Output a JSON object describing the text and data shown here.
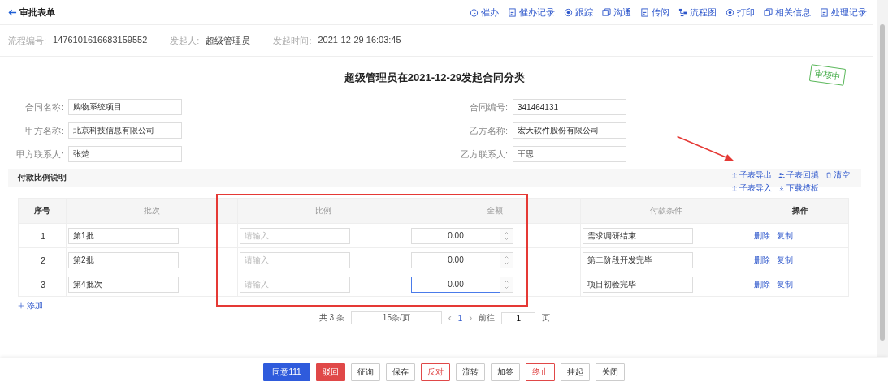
{
  "header": {
    "back_title": "审批表单",
    "actions": [
      "催办",
      "催办记录",
      "跟踪",
      "沟通",
      "传阅",
      "流程图",
      "打印",
      "相关信息",
      "处理记录"
    ]
  },
  "meta": [
    {
      "label": "流程编号:",
      "value": "1476101616683159552"
    },
    {
      "label": "发起人:",
      "value": "超级管理员"
    },
    {
      "label": "发起时间:",
      "value": "2021-12-29 16:03:45"
    }
  ],
  "form_title": "超级管理员在2021-12-29发起合同分类",
  "stamp": "审核中",
  "fields": [
    {
      "label": "合同名称:",
      "value": "购物系统项目"
    },
    {
      "label": "合同编号:",
      "value": "341464131"
    },
    {
      "label": "甲方名称:",
      "value": "北京科技信息有限公司"
    },
    {
      "label": "乙方名称:",
      "value": "宏天软件股份有限公司"
    },
    {
      "label": "甲方联系人:",
      "value": "张楚"
    },
    {
      "label": "乙方联系人:",
      "value": "王思"
    }
  ],
  "subtable": {
    "title": "付款比例说明",
    "tools_row1": [
      "子表导出",
      "子表回填",
      "清空"
    ],
    "tools_row2": [
      "子表导入",
      "下载模板"
    ],
    "columns": [
      "序号",
      "批次",
      "比例",
      "金额",
      "付款条件",
      "操作"
    ],
    "rows": [
      {
        "seq": "1",
        "batch": "第1批",
        "ratio_placeholder": "请输入",
        "amount": "0.00",
        "amount_focused": false,
        "condition": "需求调研结束",
        "actions": [
          "删除",
          "复制"
        ]
      },
      {
        "seq": "2",
        "batch": "第2批",
        "ratio_placeholder": "请输入",
        "amount": "0.00",
        "amount_focused": false,
        "condition": "第二阶段开发完毕",
        "actions": [
          "删除",
          "复制"
        ]
      },
      {
        "seq": "3",
        "batch": "第4批次",
        "ratio_placeholder": "请输入",
        "amount": "0.00",
        "amount_focused": true,
        "condition": "项目初验完毕",
        "actions": [
          "删除",
          "复制"
        ]
      }
    ],
    "add_label": "添加"
  },
  "pagination": {
    "total": "共 3 条",
    "page_size": "15条/页",
    "prev": "‹",
    "current": "1",
    "next": "›",
    "goto_label": "前往",
    "goto_value": "1",
    "page_unit": "页"
  },
  "footer_buttons": [
    {
      "label": "同意111",
      "kind": "primary"
    },
    {
      "label": "驳回",
      "kind": "danger"
    },
    {
      "label": "征询",
      "kind": "default"
    },
    {
      "label": "保存",
      "kind": "default"
    },
    {
      "label": "反对",
      "kind": "danger-outline"
    },
    {
      "label": "流转",
      "kind": "default"
    },
    {
      "label": "加签",
      "kind": "default"
    },
    {
      "label": "终止",
      "kind": "danger-outline"
    },
    {
      "label": "挂起",
      "kind": "default"
    },
    {
      "label": "关闭",
      "kind": "default"
    }
  ]
}
